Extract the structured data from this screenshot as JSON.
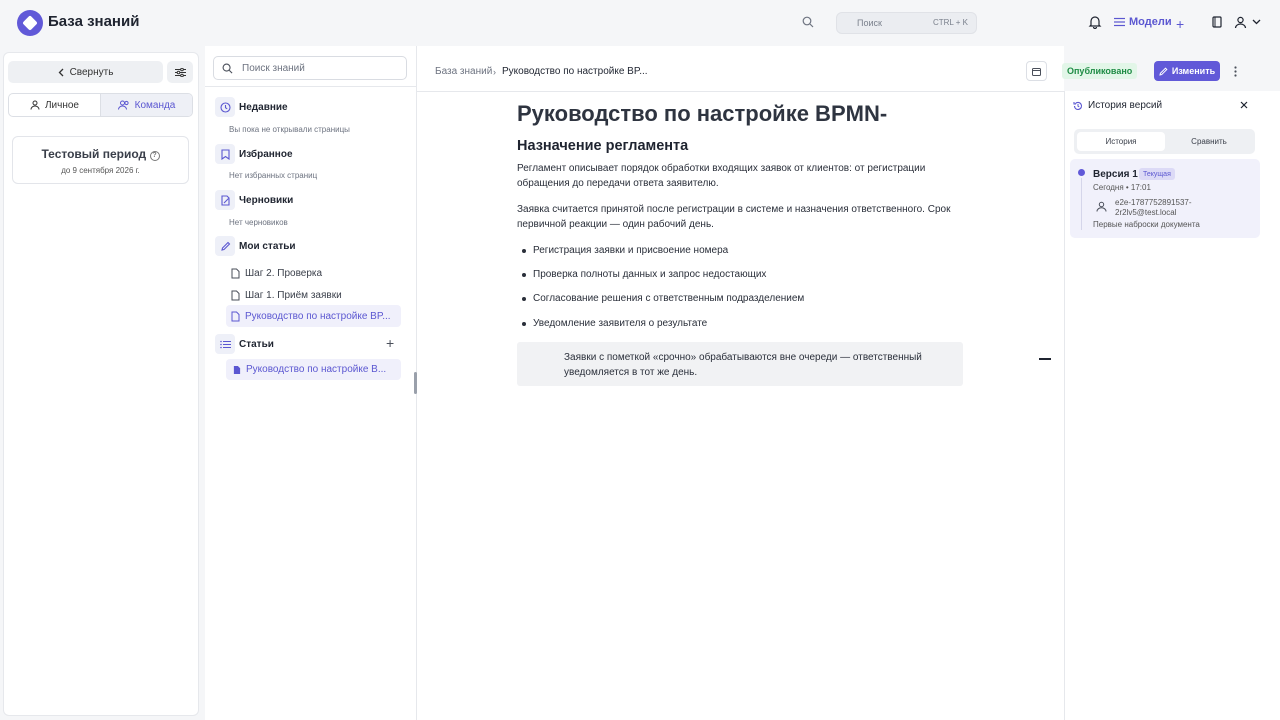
{
  "header": {
    "app_title": "База знаний",
    "search_placeholder": "Поиск",
    "search_shortcut": "CTRL + K",
    "models_label": "Модели",
    "plus_label": "+"
  },
  "left": {
    "collapse_label": "Свернуть",
    "tab_personal": "Личное",
    "tab_team": "Команда",
    "trial_title": "Тестовый период",
    "trial_until": "до 9 сентября 2026 г."
  },
  "nav": {
    "search_placeholder": "Поиск знаний",
    "recent_title": "Недавние",
    "recent_empty": "Вы пока не открывали страницы",
    "favorites_title": "Избранное",
    "favorites_empty": "Нет избранных страниц",
    "drafts_title": "Черновики",
    "drafts_empty": "Нет черновиков",
    "my_articles_title": "Мои статьи",
    "my_articles": [
      "Шаг 2. Проверка",
      "Шаг 1. Приём заявки",
      "Руководство по настройке BP..."
    ],
    "articles_title": "Статьи",
    "articles_plus": "+",
    "articles": [
      "Руководство по настройке B..."
    ]
  },
  "main": {
    "breadcrumb_root": "База знаний",
    "breadcrumb_sep": "›",
    "breadcrumb_current": "Руководство по настройке BP...",
    "status_badge": "Опубликовано",
    "edit_label": "Изменить",
    "doc_title": "Руководство по настройке BPMN-",
    "section_title": "Назначение регламента",
    "para1": "Регламент описывает порядок обработки входящих заявок от клиентов: от регистрации обращения до передачи ответа заявителю.",
    "para2": "Заявка считается принятой после регистрации в системе и назначения ответственного. Срок первичной реакции — один рабочий день.",
    "bullets": [
      "Регистрация заявки и присвоение номера",
      "Проверка полноты данных и запрос недостающих",
      "Согласование решения с ответственным подразделением",
      "Уведомление заявителя о результате"
    ],
    "callout": "Заявки с пометкой «срочно» обрабатываются вне очереди — ответственный уведомляется в тот же день."
  },
  "history": {
    "title": "История версий",
    "tab_history": "История",
    "tab_compare": "Сравнить",
    "version_name": "Версия 1",
    "version_badge": "Текущая",
    "version_time": "Сегодня • 17:01",
    "version_user": "e2e-1787752891537-2r2lv5@test.local",
    "version_note": "Первые наброски документа"
  },
  "colors": {
    "accent": "#6159d8",
    "published": "#1f8c45"
  }
}
